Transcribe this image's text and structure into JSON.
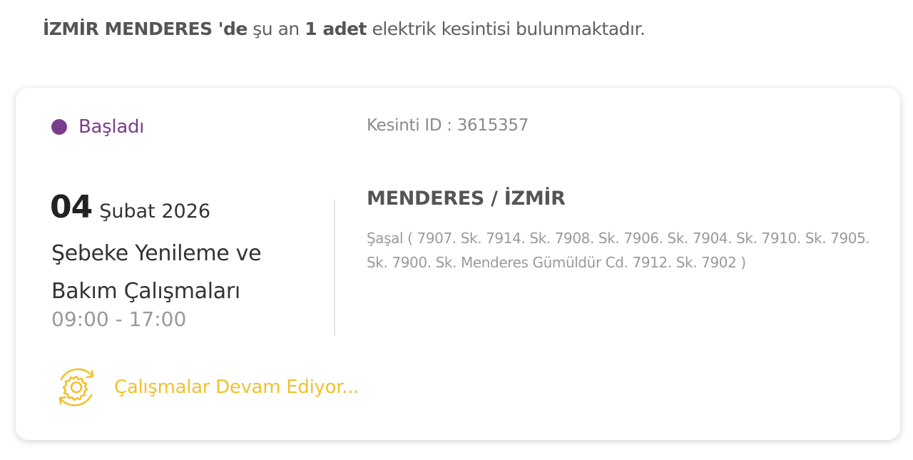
{
  "summary": {
    "place": "İZMİR MENDERES 'de",
    "text1": "şu an",
    "count": "1 adet",
    "text2": "elektrik kesintisi bulunmaktadır."
  },
  "outage": {
    "status": "Başladı",
    "id_text": "Kesinti ID : 3615357",
    "day": "04",
    "month_year": "Şubat 2026",
    "title": "Şebeke Yenileme ve Bakım Çalışmaları",
    "time": "09:00 - 17:00",
    "location": "MENDERES / İZMİR",
    "streets": "Şaşal ( 7907. Sk. 7914. Sk. 7908. Sk. 7906. Sk. 7904. Sk. 7910. Sk. 7905. Sk. 7900. Sk. Menderes Gümüldür Cd. 7912. Sk. 7902 )",
    "progress_text": "Çalışmalar Devam Ediyor...",
    "progress_icon": "gear-refresh-icon"
  },
  "colors": {
    "status": "#7a3d8c",
    "progress": "#f2c12e"
  }
}
